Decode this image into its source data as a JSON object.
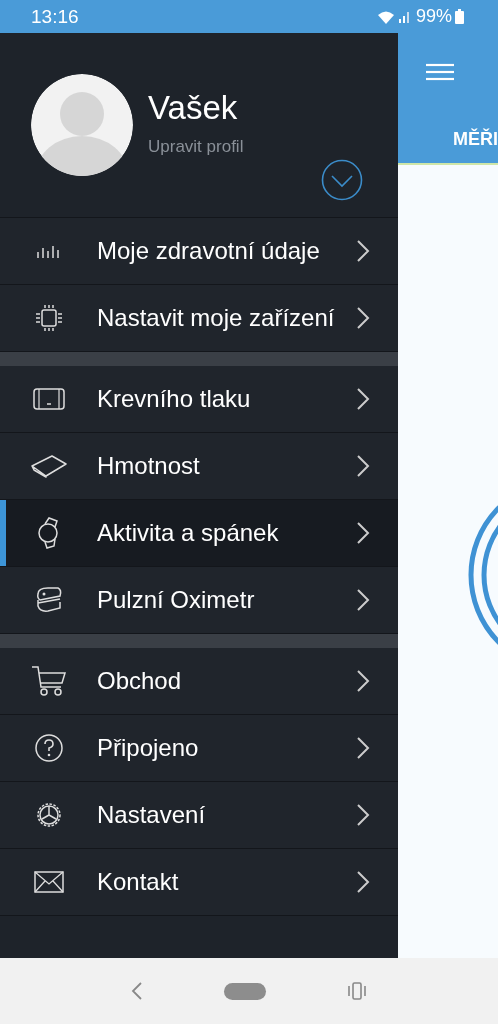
{
  "status_bar": {
    "time": "13:16",
    "battery": "99%"
  },
  "profile": {
    "name": "Vašek",
    "subtitle": "Upravit profil"
  },
  "menu_groups": [
    {
      "items": [
        {
          "label": "Moje zdravotní údaje",
          "selected": false
        },
        {
          "label": "Nastavit moje zařízení",
          "selected": false
        }
      ]
    },
    {
      "items": [
        {
          "label": "Krevního tlaku",
          "selected": false
        },
        {
          "label": "Hmotnost",
          "selected": false
        },
        {
          "label": "Aktivita a spánek",
          "selected": true
        },
        {
          "label": "Pulzní Oximetr",
          "selected": false
        }
      ]
    },
    {
      "items": [
        {
          "label": "Obchod",
          "selected": false
        },
        {
          "label": "Připojeno",
          "selected": false
        },
        {
          "label": "Nastavení",
          "selected": false
        },
        {
          "label": "Kontakt",
          "selected": false
        }
      ]
    }
  ],
  "app_behind": {
    "tab": "MĚŘI"
  }
}
